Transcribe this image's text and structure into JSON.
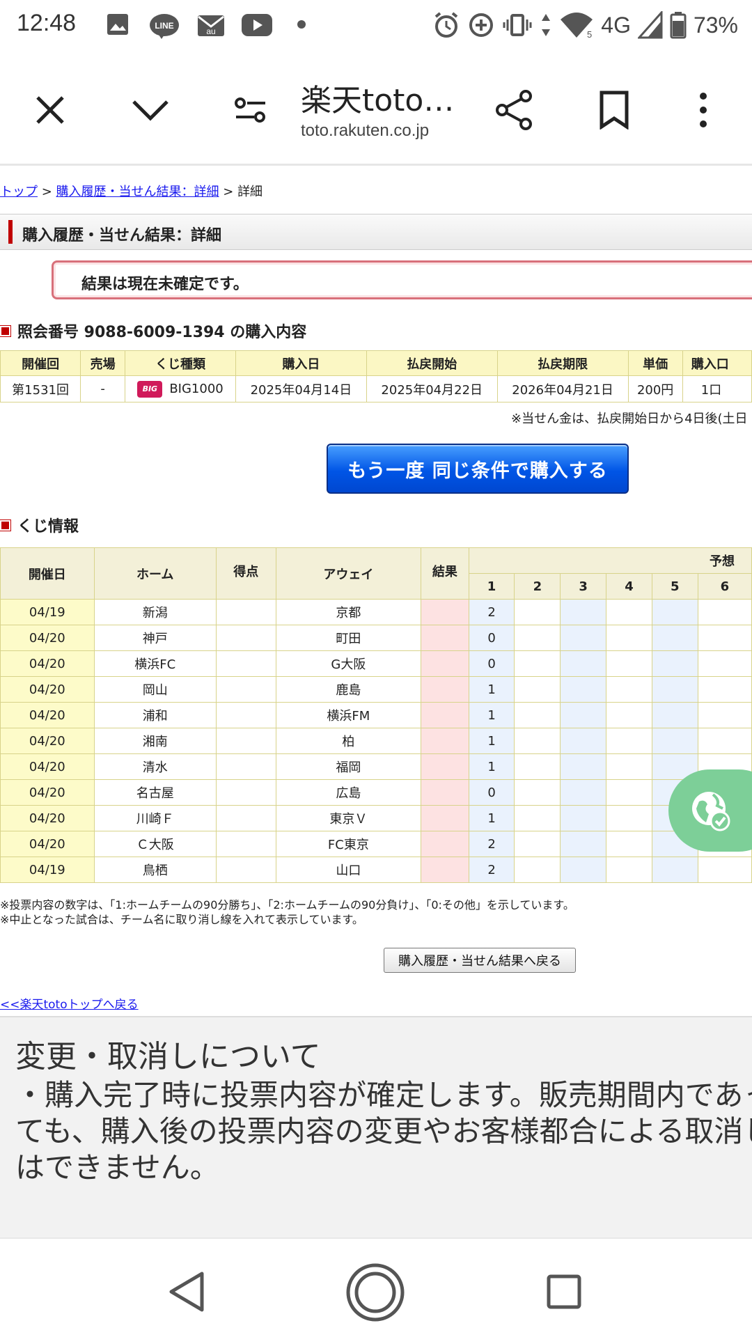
{
  "status_bar": {
    "time": "12:48",
    "network": "4G",
    "battery": "73%",
    "icons": [
      "image-icon",
      "line-icon",
      "au-mail-icon",
      "youtube-icon",
      "dot-icon",
      "alarm-icon",
      "data-saver-icon",
      "vibrate-icon",
      "data-arrows-icon",
      "wifi-icon",
      "signal-icon",
      "battery-icon"
    ],
    "line_label": "LINE",
    "au_label": "au"
  },
  "browser": {
    "title": "楽天toto…",
    "url": "toto.rakuten.co.jp"
  },
  "breadcrumb": {
    "top": "トップ",
    "sep1": " > ",
    "history": "購入履歴・当せん結果：詳細",
    "sep2": " > ",
    "current": "詳細"
  },
  "page_heading": "購入履歴・当せん結果：詳細",
  "alert": "結果は現在未確定です。",
  "purchase": {
    "heading": "照会番号 9088-6009-1394 の購入内容",
    "headers": [
      "開催回",
      "売場",
      "くじ種類",
      "購入日",
      "払戻開始",
      "払戻期限",
      "単価",
      "購入口"
    ],
    "row": {
      "round": "第1531回",
      "shop": "-",
      "logo_text": "BIG",
      "type": "BIG1000",
      "purchase_date": "2025年04月14日",
      "payout_start": "2025年04月22日",
      "payout_deadline": "2026年04月21日",
      "price": "200円",
      "units": "1口"
    },
    "note": "※当せん金は、払戻開始日から4日後(土日"
  },
  "rebuy_button": "もう一度 同じ条件で購入する",
  "lottery": {
    "heading": "くじ情報",
    "headers": {
      "date": "開催日",
      "home": "ホーム",
      "score": "得点",
      "away": "アウェイ",
      "result": "結果",
      "prediction": "予想"
    },
    "pred_cols": [
      "1",
      "2",
      "3",
      "4",
      "5",
      "6"
    ],
    "rows": [
      {
        "date": "04/19",
        "home": "新潟",
        "away": "京都",
        "pick": "2"
      },
      {
        "date": "04/20",
        "home": "神戸",
        "away": "町田",
        "pick": "0"
      },
      {
        "date": "04/20",
        "home": "横浜FC",
        "away": "G大阪",
        "pick": "0"
      },
      {
        "date": "04/20",
        "home": "岡山",
        "away": "鹿島",
        "pick": "1"
      },
      {
        "date": "04/20",
        "home": "浦和",
        "away": "横浜FM",
        "pick": "1"
      },
      {
        "date": "04/20",
        "home": "湘南",
        "away": "柏",
        "pick": "1"
      },
      {
        "date": "04/20",
        "home": "清水",
        "away": "福岡",
        "pick": "1"
      },
      {
        "date": "04/20",
        "home": "名古屋",
        "away": "広島",
        "pick": "0"
      },
      {
        "date": "04/20",
        "home": "川崎Ｆ",
        "away": "東京Ｖ",
        "pick": "1"
      },
      {
        "date": "04/20",
        "home": "Ｃ大阪",
        "away": "FC東京",
        "pick": "2"
      },
      {
        "date": "04/19",
        "home": "鳥栖",
        "away": "山口",
        "pick": "2"
      }
    ]
  },
  "footnotes": [
    "※投票内容の数字は、「1:ホームチームの90分勝ち」、「2:ホームチームの90分負け」、「0:その他」を示しています。",
    "※中止となった試合は、チーム名に取り消し線を入れて表示しています。"
  ],
  "back_button": "購入履歴・当せん結果へ戻る",
  "top_link": "<<楽天totoトップへ戻る",
  "panel": {
    "title": "変更・取消しについて",
    "body": "・購入完了時に投票内容が確定します。販売期間内であっても、購入後の投票内容の変更やお客様都合による取消しはできません。"
  }
}
